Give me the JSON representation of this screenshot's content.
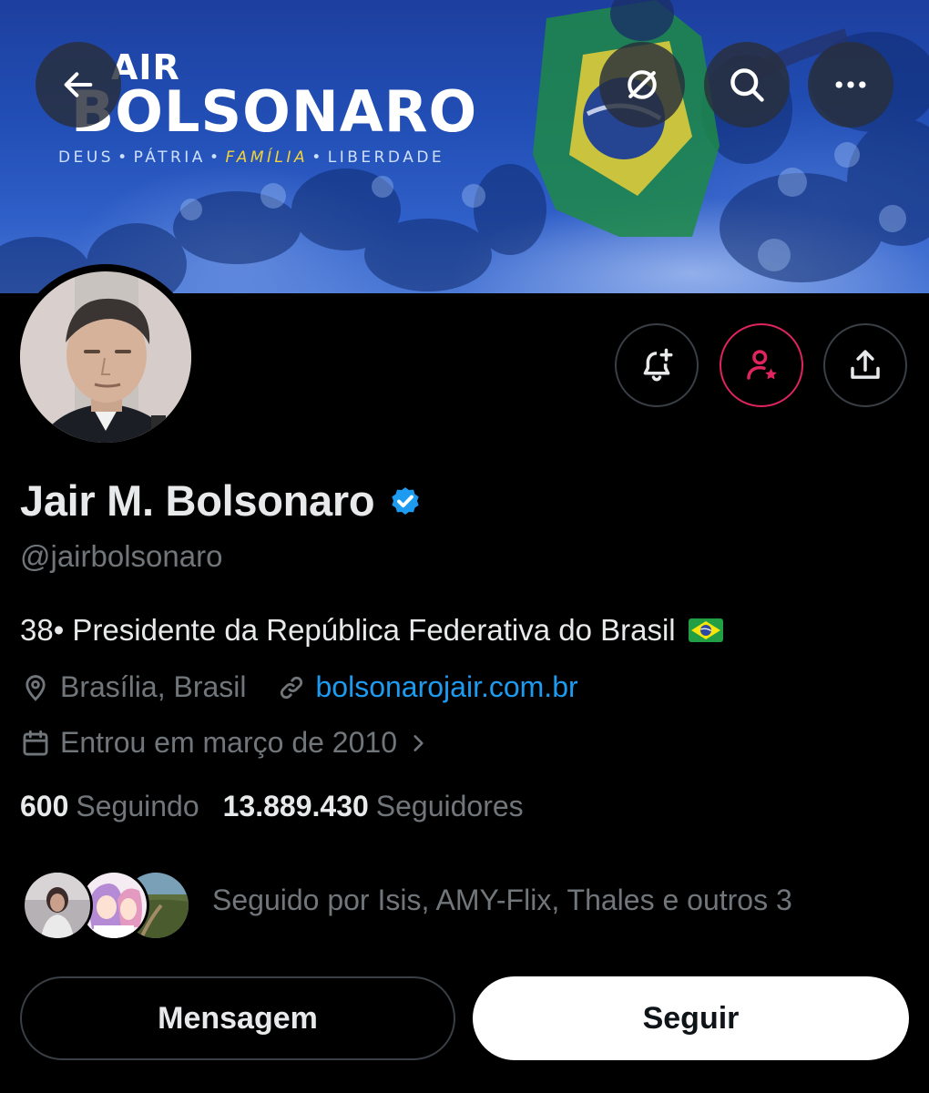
{
  "colors": {
    "background": "#000000",
    "primary_text": "#e7e9ea",
    "secondary_text": "#71767b",
    "link": "#1d9bf0",
    "verified": "#1d9bf0",
    "subscribe_accent": "#e0245e",
    "banner_blue": "#2250b7"
  },
  "banner": {
    "title_small": "AIR",
    "title_big": "BOLSONARO",
    "tagline_1": "DEUS",
    "tagline_2": "PÁTRIA",
    "tagline_3": "FAMÍLIA",
    "tagline_4": "LIBERDADE",
    "tagline_dot": "•"
  },
  "top_buttons": {
    "back_icon": "arrow-left-icon",
    "translate_icon": "translate-off-icon",
    "search_icon": "search-icon",
    "more_icon": "more-horizontal-icon"
  },
  "actions": {
    "notify_icon": "bell-plus-icon",
    "subscribe_icon": "person-star-icon",
    "share_icon": "share-icon"
  },
  "profile": {
    "name": "Jair M. Bolsonaro",
    "handle": "@jairbolsonaro",
    "bio": "38• Presidente da República Federativa do Brasil",
    "location": "Brasília, Brasil",
    "website": "bolsonarojair.com.br",
    "joined": "Entrou em março de 2010",
    "following_count": "600",
    "following_label": "Seguindo",
    "followers_count": "13.889.430",
    "followers_label": "Seguidores"
  },
  "followed_by": {
    "text": "Seguido por Isis, AMY-Flix, Thales e outros 3"
  },
  "buttons": {
    "message": "Mensagem",
    "follow": "Seguir"
  }
}
